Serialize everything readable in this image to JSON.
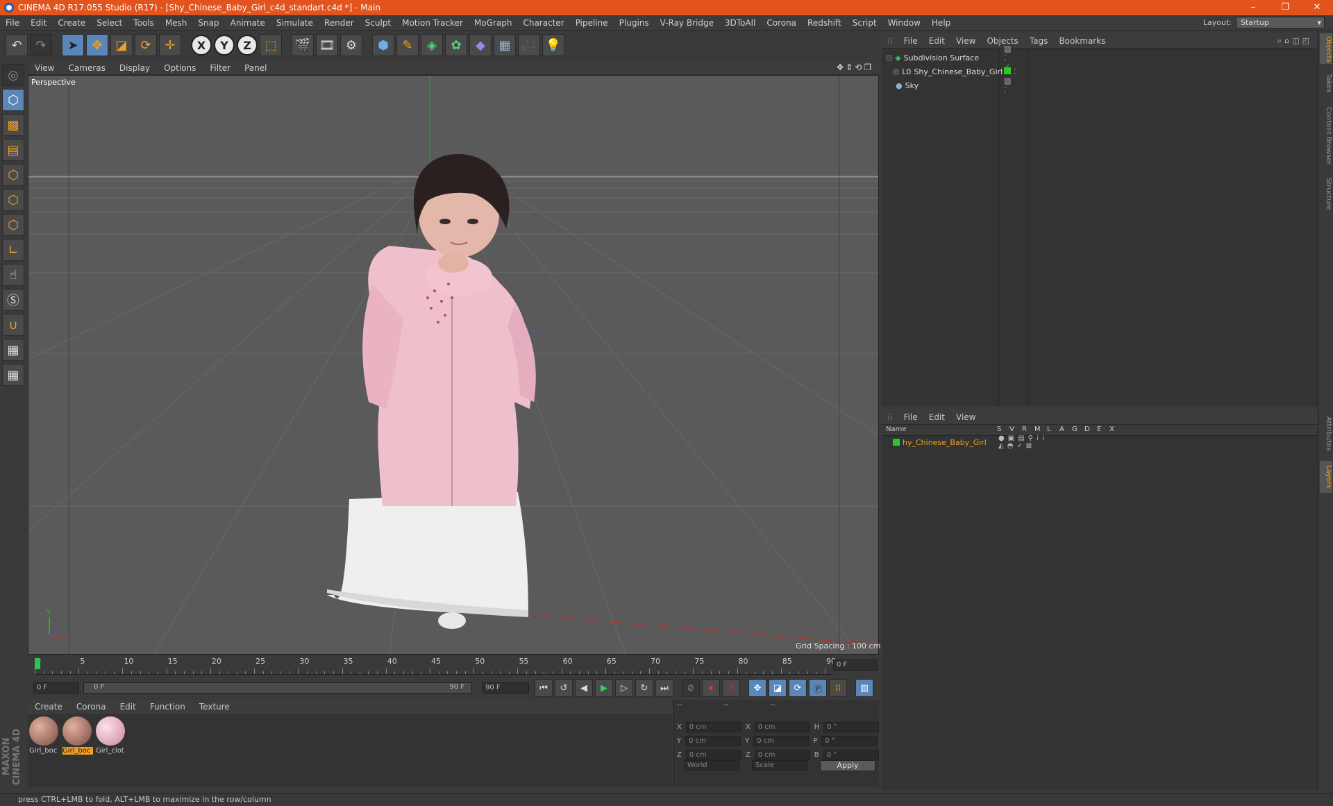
{
  "window": {
    "title": "CINEMA 4D R17.055 Studio (R17) - [Shy_Chinese_Baby_Girl_c4d_standart.c4d *] - Main",
    "controls": [
      "–",
      "❐",
      "✕"
    ]
  },
  "menubar": {
    "items": [
      "File",
      "Edit",
      "Create",
      "Select",
      "Tools",
      "Mesh",
      "Snap",
      "Animate",
      "Simulate",
      "Render",
      "Sculpt",
      "Motion Tracker",
      "MoGraph",
      "Character",
      "Pipeline",
      "Plugins",
      "V-Ray Bridge",
      "3DToAll",
      "Corona",
      "Redshift",
      "Script",
      "Window",
      "Help"
    ],
    "layout_label": "Layout:",
    "layout_value": "Startup"
  },
  "viewport": {
    "menu": [
      "View",
      "Cameras",
      "Display",
      "Options",
      "Filter",
      "Panel"
    ],
    "label": "Perspective",
    "grid_spacing": "Grid Spacing : 100 cm",
    "axis_y": "Y",
    "axis_x": "X"
  },
  "timeline": {
    "ticks": [
      "0",
      "5",
      "10",
      "15",
      "20",
      "25",
      "30",
      "35",
      "40",
      "45",
      "50",
      "55",
      "60",
      "65",
      "70",
      "75",
      "80",
      "85",
      "90"
    ],
    "current_frame": "0 F",
    "start_frame": "0 F",
    "range_start": "0 F",
    "range_end": "90 F",
    "end_frame": "90 F"
  },
  "materials": {
    "menu": [
      "Create",
      "Corona",
      "Edit",
      "Function",
      "Texture"
    ],
    "items": [
      {
        "label": "Girl_boc",
        "color": "#b07a6a",
        "selected": false
      },
      {
        "label": "Girl_boc",
        "color": "#b07a6a",
        "selected": true
      },
      {
        "label": "Girl_clot",
        "color": "#e8b8c8",
        "selected": false
      }
    ]
  },
  "coords": {
    "headers": [
      "--",
      "--",
      "--"
    ],
    "rows": [
      {
        "a": "X",
        "av": "0 cm",
        "b": "X",
        "bv": "0 cm",
        "c": "H",
        "cv": "0 °"
      },
      {
        "a": "Y",
        "av": "0 cm",
        "b": "Y",
        "bv": "0 cm",
        "c": "P",
        "cv": "0 °"
      },
      {
        "a": "Z",
        "av": "0 cm",
        "b": "Z",
        "bv": "0 cm",
        "c": "B",
        "cv": "0 °"
      }
    ],
    "world": "World",
    "scale": "Scale",
    "apply": "Apply"
  },
  "objects": {
    "menu": [
      "File",
      "Edit",
      "View",
      "Objects",
      "Tags",
      "Bookmarks"
    ],
    "items": [
      {
        "name": "Subdivision Surface",
        "indent": 0
      },
      {
        "name": "Shy_Chinese_Baby_Girl",
        "indent": 1
      },
      {
        "name": "Sky",
        "indent": 0
      }
    ]
  },
  "layers": {
    "menu": [
      "File",
      "Edit",
      "View"
    ],
    "columns": [
      "Name",
      "S",
      "V",
      "R",
      "M",
      "L",
      "A",
      "G",
      "D",
      "E",
      "X"
    ],
    "items": [
      {
        "name": "hy_Chinese_Baby_Girl",
        "color": "#22cc22"
      }
    ]
  },
  "right_tabs": [
    "Objects",
    "Takes",
    "Content Browser",
    "Structure",
    "Attributes",
    "Layers"
  ],
  "status": "press CTRL+LMB to fold, ALT+LMB to maximize in the row/column",
  "brand": {
    "line1": "MAXON",
    "line2": "CINEMA 4D"
  },
  "colors": {
    "accent": "#f0a020",
    "titlebar": "#e2531d",
    "viewport": "#5a5a5a"
  }
}
